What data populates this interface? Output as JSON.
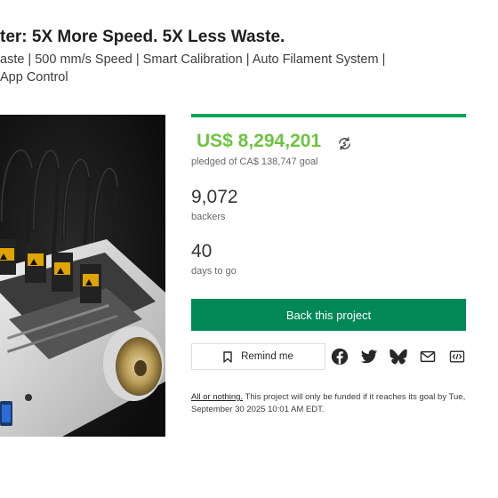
{
  "project": {
    "title": "ter: 5X More Speed. 5X Less Waste.",
    "subtitle": "aste | 500 mm/s Speed | Smart Calibration | Auto Filament System | App Control"
  },
  "hero_image": {
    "alt": ""
  },
  "funding": {
    "progress_percent": 100,
    "accent_color": "#05a35a",
    "pledged": "US$ 8,294,201",
    "pledged_color": "#6ec341",
    "goal_text": "pledged of CA$ 138,747 goal",
    "backers_count": "9,072",
    "backers_label": "backers",
    "days_count": "40",
    "days_label": "days to go"
  },
  "actions": {
    "back_label": "Back this project",
    "back_color": "#028858",
    "remind_label": "Remind me"
  },
  "share_icons": [
    "facebook-icon",
    "twitter-icon",
    "bluesky-icon",
    "email-icon",
    "embed-icon"
  ],
  "notice": {
    "link_text": "All or nothing.",
    "text": " This project will only be funded if it reaches its goal by Tue, September 30 2025 10:01 AM EDT."
  }
}
